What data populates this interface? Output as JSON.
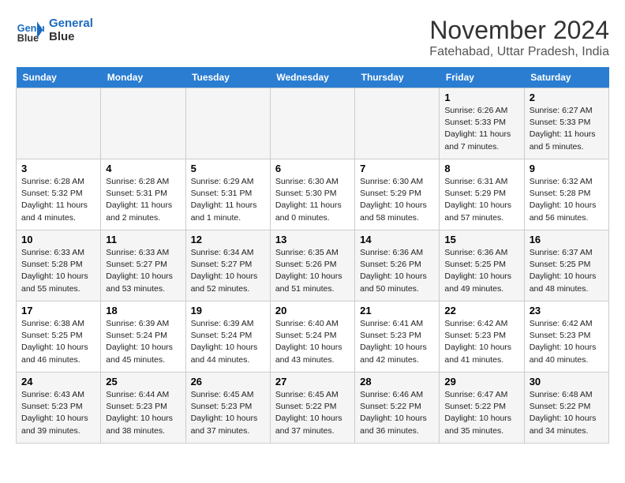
{
  "logo": {
    "line1": "General",
    "line2": "Blue"
  },
  "title": "November 2024",
  "location": "Fatehabad, Uttar Pradesh, India",
  "weekdays": [
    "Sunday",
    "Monday",
    "Tuesday",
    "Wednesday",
    "Thursday",
    "Friday",
    "Saturday"
  ],
  "weeks": [
    [
      {
        "day": "",
        "content": ""
      },
      {
        "day": "",
        "content": ""
      },
      {
        "day": "",
        "content": ""
      },
      {
        "day": "",
        "content": ""
      },
      {
        "day": "",
        "content": ""
      },
      {
        "day": "1",
        "content": "Sunrise: 6:26 AM\nSunset: 5:33 PM\nDaylight: 11 hours and 7 minutes."
      },
      {
        "day": "2",
        "content": "Sunrise: 6:27 AM\nSunset: 5:33 PM\nDaylight: 11 hours and 5 minutes."
      }
    ],
    [
      {
        "day": "3",
        "content": "Sunrise: 6:28 AM\nSunset: 5:32 PM\nDaylight: 11 hours and 4 minutes."
      },
      {
        "day": "4",
        "content": "Sunrise: 6:28 AM\nSunset: 5:31 PM\nDaylight: 11 hours and 2 minutes."
      },
      {
        "day": "5",
        "content": "Sunrise: 6:29 AM\nSunset: 5:31 PM\nDaylight: 11 hours and 1 minute."
      },
      {
        "day": "6",
        "content": "Sunrise: 6:30 AM\nSunset: 5:30 PM\nDaylight: 11 hours and 0 minutes."
      },
      {
        "day": "7",
        "content": "Sunrise: 6:30 AM\nSunset: 5:29 PM\nDaylight: 10 hours and 58 minutes."
      },
      {
        "day": "8",
        "content": "Sunrise: 6:31 AM\nSunset: 5:29 PM\nDaylight: 10 hours and 57 minutes."
      },
      {
        "day": "9",
        "content": "Sunrise: 6:32 AM\nSunset: 5:28 PM\nDaylight: 10 hours and 56 minutes."
      }
    ],
    [
      {
        "day": "10",
        "content": "Sunrise: 6:33 AM\nSunset: 5:28 PM\nDaylight: 10 hours and 55 minutes."
      },
      {
        "day": "11",
        "content": "Sunrise: 6:33 AM\nSunset: 5:27 PM\nDaylight: 10 hours and 53 minutes."
      },
      {
        "day": "12",
        "content": "Sunrise: 6:34 AM\nSunset: 5:27 PM\nDaylight: 10 hours and 52 minutes."
      },
      {
        "day": "13",
        "content": "Sunrise: 6:35 AM\nSunset: 5:26 PM\nDaylight: 10 hours and 51 minutes."
      },
      {
        "day": "14",
        "content": "Sunrise: 6:36 AM\nSunset: 5:26 PM\nDaylight: 10 hours and 50 minutes."
      },
      {
        "day": "15",
        "content": "Sunrise: 6:36 AM\nSunset: 5:25 PM\nDaylight: 10 hours and 49 minutes."
      },
      {
        "day": "16",
        "content": "Sunrise: 6:37 AM\nSunset: 5:25 PM\nDaylight: 10 hours and 48 minutes."
      }
    ],
    [
      {
        "day": "17",
        "content": "Sunrise: 6:38 AM\nSunset: 5:25 PM\nDaylight: 10 hours and 46 minutes."
      },
      {
        "day": "18",
        "content": "Sunrise: 6:39 AM\nSunset: 5:24 PM\nDaylight: 10 hours and 45 minutes."
      },
      {
        "day": "19",
        "content": "Sunrise: 6:39 AM\nSunset: 5:24 PM\nDaylight: 10 hours and 44 minutes."
      },
      {
        "day": "20",
        "content": "Sunrise: 6:40 AM\nSunset: 5:24 PM\nDaylight: 10 hours and 43 minutes."
      },
      {
        "day": "21",
        "content": "Sunrise: 6:41 AM\nSunset: 5:23 PM\nDaylight: 10 hours and 42 minutes."
      },
      {
        "day": "22",
        "content": "Sunrise: 6:42 AM\nSunset: 5:23 PM\nDaylight: 10 hours and 41 minutes."
      },
      {
        "day": "23",
        "content": "Sunrise: 6:42 AM\nSunset: 5:23 PM\nDaylight: 10 hours and 40 minutes."
      }
    ],
    [
      {
        "day": "24",
        "content": "Sunrise: 6:43 AM\nSunset: 5:23 PM\nDaylight: 10 hours and 39 minutes."
      },
      {
        "day": "25",
        "content": "Sunrise: 6:44 AM\nSunset: 5:23 PM\nDaylight: 10 hours and 38 minutes."
      },
      {
        "day": "26",
        "content": "Sunrise: 6:45 AM\nSunset: 5:23 PM\nDaylight: 10 hours and 37 minutes."
      },
      {
        "day": "27",
        "content": "Sunrise: 6:45 AM\nSunset: 5:22 PM\nDaylight: 10 hours and 37 minutes."
      },
      {
        "day": "28",
        "content": "Sunrise: 6:46 AM\nSunset: 5:22 PM\nDaylight: 10 hours and 36 minutes."
      },
      {
        "day": "29",
        "content": "Sunrise: 6:47 AM\nSunset: 5:22 PM\nDaylight: 10 hours and 35 minutes."
      },
      {
        "day": "30",
        "content": "Sunrise: 6:48 AM\nSunset: 5:22 PM\nDaylight: 10 hours and 34 minutes."
      }
    ]
  ]
}
